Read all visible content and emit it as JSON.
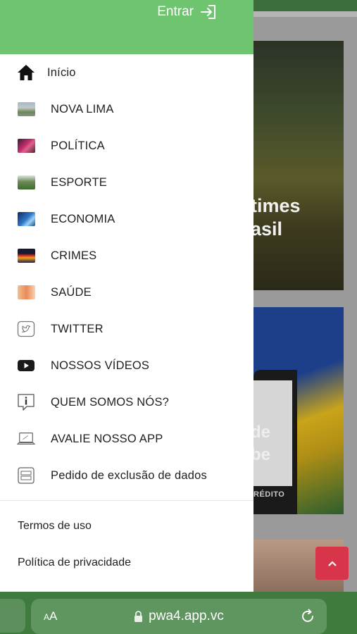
{
  "header": {
    "login_label": "Entrar"
  },
  "menu": {
    "items": [
      {
        "label": "Início",
        "icon": "home-icon"
      },
      {
        "label": "NOVA LIMA",
        "icon": "nova-lima-thumb"
      },
      {
        "label": "POLÍTICA",
        "icon": "politica-thumb"
      },
      {
        "label": "ESPORTE",
        "icon": "esporte-thumb"
      },
      {
        "label": "ECONOMIA",
        "icon": "economia-thumb"
      },
      {
        "label": "CRIMES",
        "icon": "crimes-thumb"
      },
      {
        "label": "SAÚDE",
        "icon": "saude-thumb"
      },
      {
        "label": "TWITTER",
        "icon": "twitter-icon"
      },
      {
        "label": "NOSSOS VÍDEOS",
        "icon": "youtube-icon"
      },
      {
        "label": "QUEM SOMOS NÓS?",
        "icon": "info-icon"
      },
      {
        "label": "AVALIE NOSSO APP",
        "icon": "laptop-icon"
      },
      {
        "label": "Pedido de exclusão de dados",
        "icon": "data-form-icon"
      }
    ]
  },
  "footer": {
    "terms": "Termos de uso",
    "privacy": "Política de privacidade"
  },
  "background": {
    "card1_text_line1": "times",
    "card1_text_line2": "asil",
    "card2_text_line1": "de",
    "card2_text_line2": "be",
    "card2_credit": "RÉDITO"
  },
  "browser": {
    "aa_small": "A",
    "aa_large": "A",
    "url": "pwa4.app.vc"
  },
  "colors": {
    "header_green": "#6fc46f",
    "browser_green": "#3f7a3f",
    "scroll_button": "#d8344a"
  }
}
